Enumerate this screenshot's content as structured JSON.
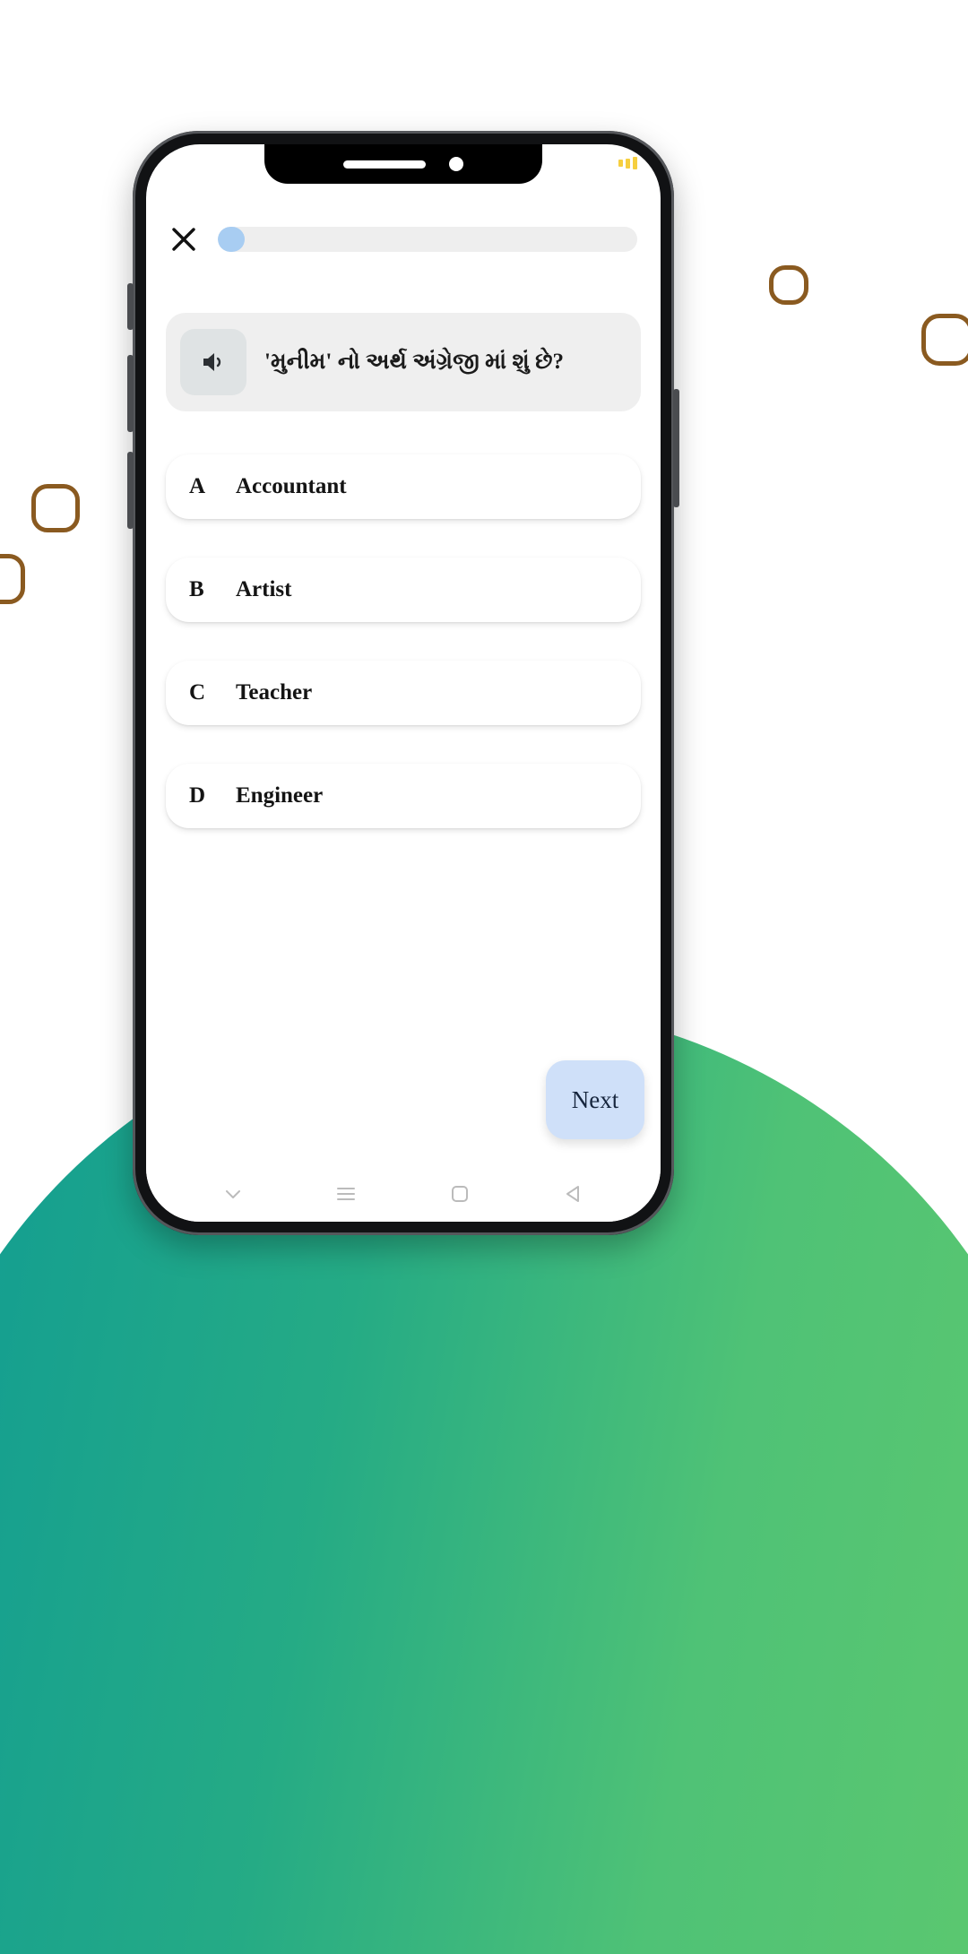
{
  "background": {
    "blob_color_left": "#0f9b94",
    "blob_color_right": "#5ec96e",
    "page_color": "#ffffff",
    "deco_square_color": "#8a5a20",
    "sparkle_color": "#ffffff"
  },
  "device": {
    "frame_color": "#111214",
    "screen_color": "#ffffff",
    "status_battery_color": "#f6cf3f"
  },
  "app": {
    "topbar": {
      "close_icon": "close-icon",
      "progress_percent": 4,
      "progress_track_color": "#eeeeee",
      "progress_knob_color": "#a8cdf2"
    },
    "question": {
      "speaker_icon": "speaker-icon",
      "text": "'મુનીમ' નો અર્થ અંગ્રેજી માં શું છે?",
      "card_color": "#efefef",
      "speaker_button_color": "#dfe3e4"
    },
    "options": [
      {
        "letter": "A",
        "label": "Accountant"
      },
      {
        "letter": "B",
        "label": "Artist"
      },
      {
        "letter": "C",
        "label": "Teacher"
      },
      {
        "letter": "D",
        "label": "Engineer"
      }
    ],
    "next_button": {
      "label": "Next",
      "background": "#cfe0f9",
      "text_color": "#16253d"
    },
    "navbar": {
      "items": [
        {
          "icon": "chevron-down-icon"
        },
        {
          "icon": "menu-icon"
        },
        {
          "icon": "home-square-icon"
        },
        {
          "icon": "back-triangle-icon"
        }
      ]
    }
  }
}
